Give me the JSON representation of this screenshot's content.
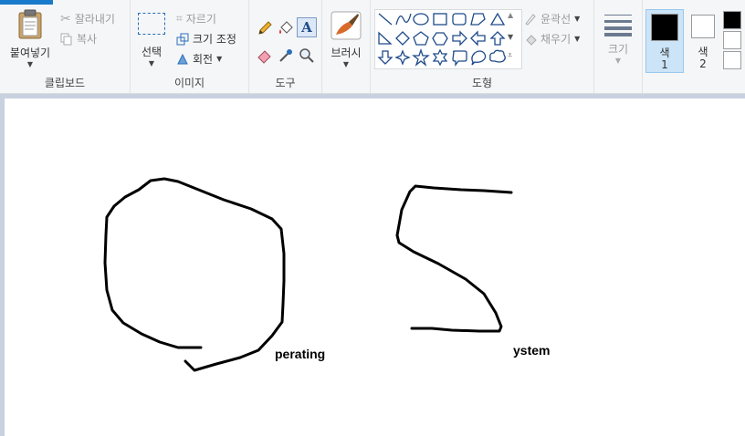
{
  "ribbon": {
    "clipboard": {
      "label": "클립보드",
      "paste": "붙여넣기",
      "cut": "잘라내기",
      "copy": "복사"
    },
    "image": {
      "label": "이미지",
      "select": "선택",
      "crop": "자르기",
      "resize": "크기 조정",
      "rotate": "회전"
    },
    "tools": {
      "label": "도구",
      "icons": [
        "pencil-icon",
        "fill-icon",
        "text-icon",
        "eraser-icon",
        "color-picker-icon",
        "magnifier-icon"
      ]
    },
    "brushes": {
      "label": "브러시"
    },
    "shapes": {
      "label": "도형",
      "outline": "윤곽선",
      "fill": "채우기",
      "items": [
        "line",
        "curve",
        "oval",
        "rectangle",
        "rounded-rectangle",
        "polygon",
        "triangle",
        "right-triangle",
        "diamond",
        "pentagon",
        "hexagon",
        "right-arrow",
        "left-arrow",
        "up-arrow",
        "down-arrow",
        "four-point-star",
        "five-point-star",
        "six-point-star",
        "rounded-callout",
        "oval-callout",
        "cloud-callout"
      ]
    },
    "size": {
      "label": "크기"
    },
    "colors": {
      "color1": "색\n1",
      "color1_a": "색",
      "color1_b": "1",
      "color2_a": "색",
      "color2_b": "2",
      "color1_value": "#000000",
      "color2_value": "#ffffff"
    }
  },
  "canvas": {
    "text1": "perating",
    "text2": "ystem",
    "stroke_color": "#000000"
  }
}
